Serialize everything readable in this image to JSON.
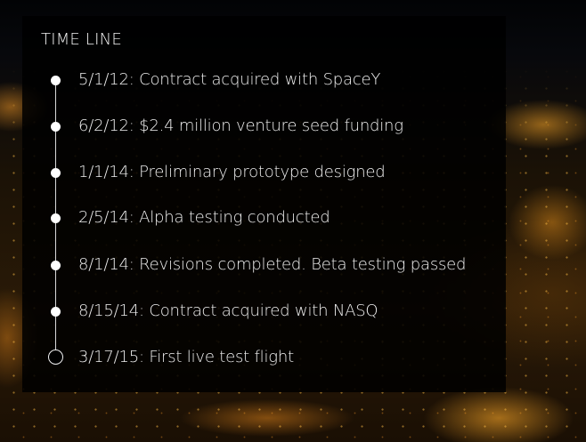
{
  "timeline": {
    "title": "TIME LINE",
    "entries": [
      {
        "text": "5/1/12: Contract acquired with SpaceY",
        "marker": "filled"
      },
      {
        "text": "6/2/12: $2.4 million venture seed funding",
        "marker": "filled"
      },
      {
        "text": "1/1/14: Preliminary prototype designed",
        "marker": "filled"
      },
      {
        "text": "2/5/14: Alpha testing conducted",
        "marker": "filled"
      },
      {
        "text": "8/1/14: Revisions completed. Beta testing passed",
        "marker": "filled"
      },
      {
        "text": "8/15/14: Contract acquired with NASQ",
        "marker": "filled"
      },
      {
        "text": "3/17/15: First live test flight",
        "marker": "open"
      }
    ]
  },
  "colors": {
    "panel": "#000000",
    "text": "#efefef",
    "accent_glow": "#ffaa28"
  }
}
